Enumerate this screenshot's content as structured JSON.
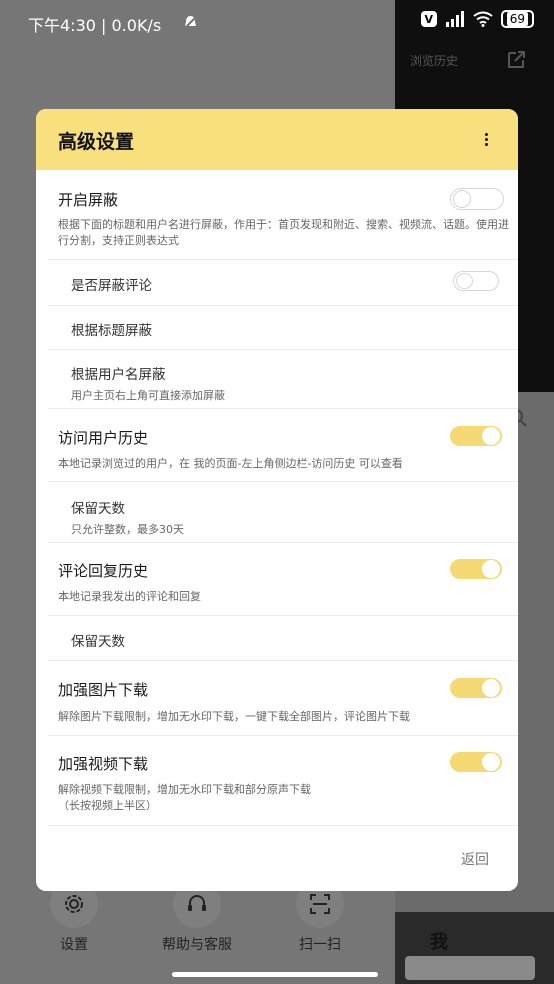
{
  "status_bar": {
    "time": "下午4:30 | 0.0K/s",
    "vpn_badge": "V",
    "battery": "69"
  },
  "background": {
    "top_right_text": "浏览历史",
    "bottom_nav": [
      {
        "label": "设置",
        "icon": "gear-icon"
      },
      {
        "label": "帮助与客服",
        "icon": "headset-icon"
      },
      {
        "label": "扫一扫",
        "icon": "scan-icon"
      }
    ],
    "me_tab": "我"
  },
  "dialog": {
    "title": "高级设置",
    "back_label": "返回",
    "rows": [
      {
        "title": "开启屏蔽",
        "desc": "根据下面的标题和用户名进行屏蔽，作用于：首页发现和附近、搜索、视频流、话题。使用进行分割，支持正则表达式",
        "toggle": "off"
      },
      {
        "title": "是否屏蔽评论",
        "toggle": "off"
      },
      {
        "title": "根据标题屏蔽"
      },
      {
        "title": "根据用户名屏蔽",
        "desc": "用户主页右上角可直接添加屏蔽"
      },
      {
        "title": "访问用户历史",
        "desc": "本地记录浏览过的用户，在 我的页面-左上角侧边栏-访问历史 可以查看",
        "toggle": "on"
      },
      {
        "title": "保留天数",
        "desc": "只允许整数，最多30天"
      },
      {
        "title": "评论回复历史",
        "desc": "本地记录我发出的评论和回复",
        "toggle": "on"
      },
      {
        "title": "保留天数"
      },
      {
        "title": "加强图片下载",
        "desc": "解除图片下载限制，增加无水印下载，一键下载全部图片，评论图片下载",
        "toggle": "on"
      },
      {
        "title": "加强视频下载",
        "desc": "解除视频下载限制，增加无水印下载和部分原声下载\n（长按视频上半区）",
        "toggle": "on"
      }
    ]
  },
  "colors": {
    "accent": "#f8e07e",
    "toggle_on": "#f5d973"
  }
}
